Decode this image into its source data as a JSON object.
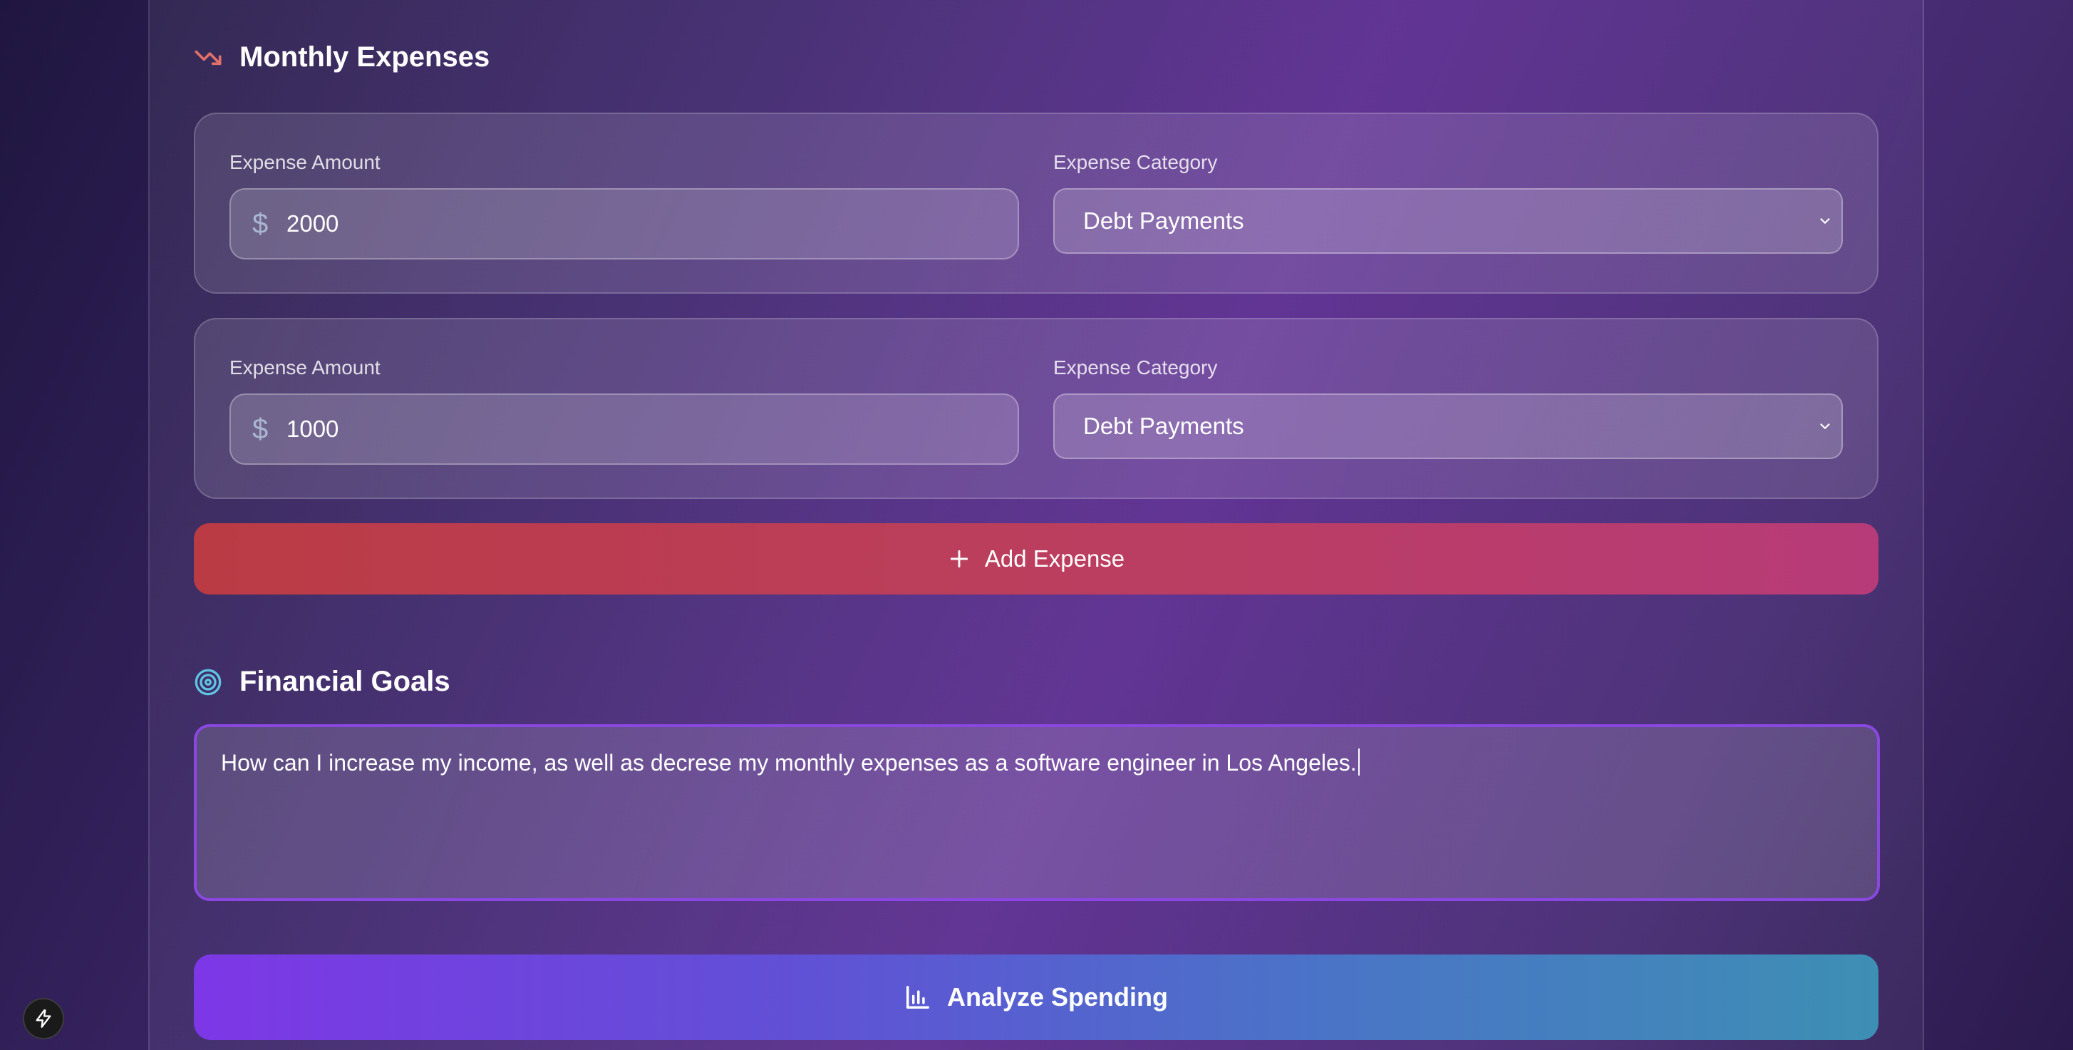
{
  "monthly_expenses": {
    "title": "Monthly Expenses",
    "icon": "trending-down-icon",
    "accent_color": "#e0706a",
    "entries": [
      {
        "amount_label": "Expense Amount",
        "currency_symbol": "$",
        "amount": "2000",
        "category_label": "Expense Category",
        "category": "Debt Payments"
      },
      {
        "amount_label": "Expense Amount",
        "currency_symbol": "$",
        "amount": "1000",
        "category_label": "Expense Category",
        "category": "Debt Payments"
      }
    ],
    "add_button_label": "Add Expense"
  },
  "financial_goals": {
    "title": "Financial Goals",
    "icon": "target-icon",
    "accent_color": "#5fc3e4",
    "goal_text": "How can I increase my income, as well as decrese my monthly expenses as a software engineer in Los Angeles."
  },
  "analyze_button_label": "Analyze Spending",
  "colors": {
    "add_button_start": "#bb3b44",
    "add_button_end": "#b73b78",
    "analyze_button_start": "#7d37e6",
    "analyze_button_end": "#3d8fb4",
    "focus_border": "#8a48e0"
  }
}
